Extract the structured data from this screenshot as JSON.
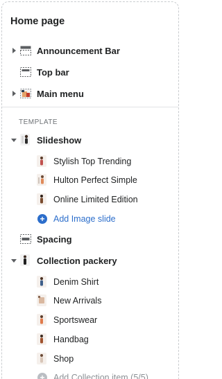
{
  "header": {
    "title": "Home page"
  },
  "sections": [
    {
      "label": "Announcement Bar",
      "icon": "announcement-bar-icon"
    },
    {
      "label": "Top bar",
      "icon": "top-bar-icon"
    },
    {
      "label": "Main menu",
      "icon": "main-menu-icon"
    }
  ],
  "template": {
    "heading": "TEMPLATE",
    "slideshow": {
      "label": "Slideshow",
      "items": [
        {
          "label": "Stylish Top Trending"
        },
        {
          "label": "Hulton Perfect Simple"
        },
        {
          "label": "Online Limited Edition"
        }
      ],
      "add_label": "Add Image slide"
    },
    "spacing": {
      "label": "Spacing"
    },
    "collection": {
      "label": "Collection packery",
      "items": [
        {
          "label": "Denim Shirt"
        },
        {
          "label": "New Arrivals"
        },
        {
          "label": "Sportswear"
        },
        {
          "label": "Handbag"
        },
        {
          "label": "Shop"
        }
      ],
      "add_label": "Add Collection item (5/5)"
    }
  },
  "colors": {
    "link": "#2c6ecb",
    "text": "#202223",
    "muted": "#6d7175",
    "disabled": "#8c9196"
  }
}
